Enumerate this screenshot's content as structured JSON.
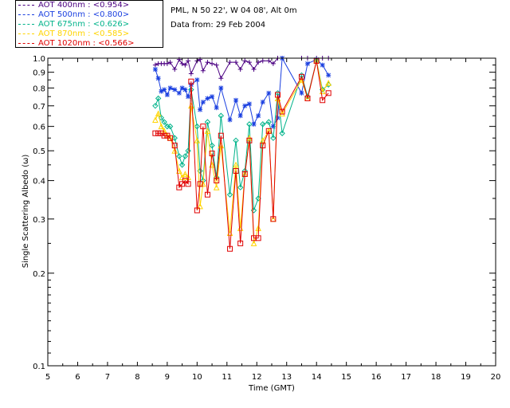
{
  "header": {
    "location": "PML, N 50 22', W 04 08', Alt 0m",
    "date": "Data from: 29 Feb 2004"
  },
  "legend": [
    {
      "label": "AOT  400nm : <0.954>",
      "color": "#4b0082"
    },
    {
      "label": "AOT  500nm : <0.800>",
      "color": "#1a3fe0"
    },
    {
      "label": "AOT  675nm : <0.626>",
      "color": "#00b38a"
    },
    {
      "label": "AOT  870nm : <0.585>",
      "color": "#ffd400"
    },
    {
      "label": "AOT 1020nm : <0.566>",
      "color": "#e00000"
    }
  ],
  "chart_data": {
    "type": "line",
    "xlabel": "Time (GMT)",
    "ylabel": "Single Scattering Albedo (ω)",
    "xlim": [
      5,
      20
    ],
    "ylim": [
      0.1,
      1.0
    ],
    "yscale": "log",
    "xticks": [
      "5",
      "6",
      "7",
      "8",
      "9",
      "10",
      "11",
      "12",
      "13",
      "14",
      "15",
      "16",
      "17",
      "18",
      "19",
      "20"
    ],
    "yticks": [
      {
        "v": 1.0,
        "l": "1.0"
      },
      {
        "v": 0.9,
        "l": "0.9"
      },
      {
        "v": 0.8,
        "l": "0.8"
      },
      {
        "v": 0.7,
        "l": "0.7"
      },
      {
        "v": 0.6,
        "l": "0.6"
      },
      {
        "v": 0.5,
        "l": "0.5"
      },
      {
        "v": 0.4,
        "l": "0.4"
      },
      {
        "v": 0.3,
        "l": "0.3"
      },
      {
        "v": 0.2,
        "l": "0.2"
      },
      {
        "v": 0.1,
        "l": "0.1"
      }
    ],
    "series": [
      {
        "name": "AOT  400nm",
        "color": "#4b0082",
        "marker": "plus",
        "x": [
          8.6,
          8.7,
          8.8,
          8.9,
          9.0,
          9.1,
          9.25,
          9.4,
          9.5,
          9.6,
          9.7,
          9.8,
          10.0,
          10.1,
          10.2,
          10.35,
          10.5,
          10.65,
          10.8,
          11.1,
          11.3,
          11.45,
          11.6,
          11.75,
          11.9,
          12.05,
          12.2,
          12.4,
          12.55,
          12.7,
          12.85,
          13.5,
          13.7,
          14.0,
          14.2,
          14.4
        ],
        "y": [
          0.95,
          0.96,
          0.96,
          0.96,
          0.96,
          0.97,
          0.92,
          0.99,
          0.96,
          0.95,
          0.98,
          0.89,
          0.98,
          0.99,
          0.91,
          0.97,
          0.96,
          0.95,
          0.86,
          0.97,
          0.97,
          0.92,
          0.98,
          0.97,
          0.92,
          0.97,
          0.98,
          0.98,
          0.96,
          1.0,
          1.0,
          1.0,
          1.0,
          1.0,
          1.0,
          1.0
        ]
      },
      {
        "name": "AOT  500nm",
        "color": "#1a3fe0",
        "marker": "asterisk",
        "x": [
          8.6,
          8.7,
          8.8,
          8.9,
          9.0,
          9.1,
          9.25,
          9.4,
          9.5,
          9.6,
          9.7,
          9.8,
          10.0,
          10.1,
          10.2,
          10.35,
          10.5,
          10.65,
          10.8,
          11.1,
          11.3,
          11.45,
          11.6,
          11.75,
          11.9,
          12.05,
          12.2,
          12.4,
          12.55,
          12.7,
          12.85,
          13.5,
          13.7,
          14.0,
          14.2,
          14.4
        ],
        "y": [
          0.92,
          0.86,
          0.78,
          0.79,
          0.76,
          0.8,
          0.79,
          0.77,
          0.8,
          0.79,
          0.75,
          0.82,
          0.85,
          0.68,
          0.72,
          0.74,
          0.75,
          0.69,
          0.8,
          0.63,
          0.73,
          0.65,
          0.7,
          0.71,
          0.61,
          0.65,
          0.72,
          0.77,
          0.6,
          0.64,
          1.0,
          0.77,
          0.96,
          0.99,
          0.95,
          0.88
        ]
      },
      {
        "name": "AOT  675nm",
        "color": "#00b38a",
        "marker": "diamond",
        "x": [
          8.6,
          8.7,
          8.8,
          8.9,
          9.0,
          9.1,
          9.25,
          9.4,
          9.5,
          9.6,
          9.7,
          9.8,
          10.0,
          10.1,
          10.2,
          10.35,
          10.5,
          10.65,
          10.8,
          11.1,
          11.3,
          11.45,
          11.6,
          11.75,
          11.9,
          12.05,
          12.2,
          12.4,
          12.55,
          12.7,
          12.85,
          13.5,
          13.7,
          14.0,
          14.2,
          14.4
        ],
        "y": [
          0.7,
          0.74,
          0.64,
          0.62,
          0.6,
          0.6,
          0.55,
          0.48,
          0.45,
          0.48,
          0.5,
          0.79,
          0.6,
          0.43,
          0.4,
          0.62,
          0.52,
          0.41,
          0.65,
          0.36,
          0.54,
          0.38,
          0.43,
          0.61,
          0.32,
          0.35,
          0.61,
          0.62,
          0.55,
          0.77,
          0.57,
          0.88,
          0.75,
          0.98,
          0.79,
          0.82
        ]
      },
      {
        "name": "AOT  870nm",
        "color": "#ffd400",
        "marker": "triangle",
        "x": [
          8.6,
          8.7,
          8.8,
          8.9,
          9.0,
          9.1,
          9.25,
          9.4,
          9.5,
          9.6,
          9.7,
          9.8,
          10.0,
          10.1,
          10.2,
          10.35,
          10.5,
          10.65,
          10.8,
          11.1,
          11.3,
          11.45,
          11.6,
          11.75,
          11.9,
          12.05,
          12.2,
          12.4,
          12.55,
          12.7,
          12.85,
          13.5,
          13.7,
          14.0,
          14.2,
          14.4
        ],
        "y": [
          0.63,
          0.66,
          0.6,
          0.58,
          0.56,
          0.55,
          0.5,
          0.43,
          0.41,
          0.42,
          0.41,
          0.7,
          0.54,
          0.33,
          0.39,
          0.58,
          0.45,
          0.38,
          0.52,
          0.27,
          0.45,
          0.28,
          0.42,
          0.55,
          0.25,
          0.28,
          0.54,
          0.58,
          0.3,
          0.74,
          0.66,
          0.85,
          0.74,
          0.98,
          0.78,
          0.83
        ]
      },
      {
        "name": "AOT 1020nm",
        "color": "#e00000",
        "marker": "square",
        "x": [
          8.6,
          8.7,
          8.8,
          8.9,
          9.0,
          9.1,
          9.25,
          9.4,
          9.5,
          9.6,
          9.7,
          9.8,
          10.0,
          10.1,
          10.2,
          10.35,
          10.5,
          10.65,
          10.8,
          11.1,
          11.3,
          11.45,
          11.6,
          11.75,
          11.9,
          12.05,
          12.2,
          12.4,
          12.55,
          12.7,
          12.85,
          13.5,
          13.7,
          14.0,
          14.2,
          14.4
        ],
        "y": [
          0.57,
          0.57,
          0.57,
          0.56,
          0.56,
          0.55,
          0.52,
          0.38,
          0.39,
          0.4,
          0.39,
          0.84,
          0.32,
          0.39,
          0.6,
          0.36,
          0.49,
          0.4,
          0.56,
          0.24,
          0.43,
          0.25,
          0.42,
          0.54,
          0.26,
          0.26,
          0.52,
          0.58,
          0.3,
          0.76,
          0.67,
          0.87,
          0.74,
          0.98,
          0.73,
          0.77
        ]
      }
    ]
  }
}
